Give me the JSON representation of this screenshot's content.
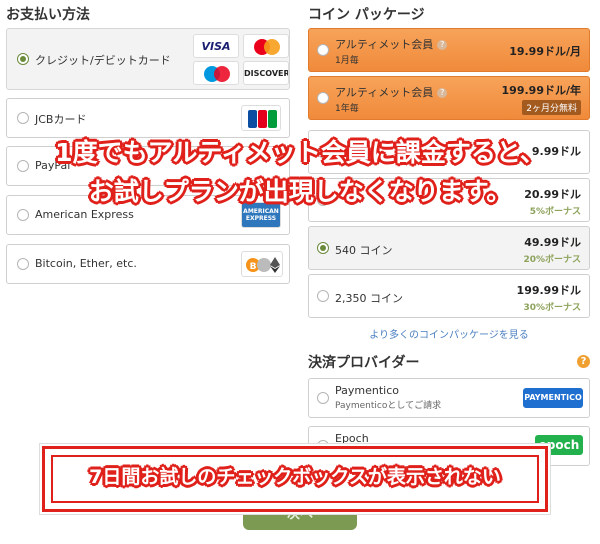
{
  "payment": {
    "title": "お支払い方法",
    "methods": [
      {
        "label": "クレジット/デビットカード",
        "selected": true
      },
      {
        "label": "JCBカード",
        "selected": false
      },
      {
        "label": "PayPal",
        "selected": false
      },
      {
        "label": "American Express",
        "selected": false
      },
      {
        "label": "Bitcoin, Ether, etc.",
        "selected": false
      }
    ],
    "logos": {
      "visa": "VISA",
      "discover": "DISCOVER",
      "jcb": "JCB",
      "amex": "AMERICAN EXPRESS"
    }
  },
  "coins": {
    "title": "コイン パッケージ",
    "packages": [
      {
        "name": "アルティメット会員",
        "sub": "1月毎",
        "price": "19.99ドル/月",
        "badge": ""
      },
      {
        "name": "アルティメット会員",
        "sub": "1年毎",
        "price": "199.99ドル/年",
        "badge": "2ヶ月分無料"
      },
      {
        "name": "",
        "sub": "",
        "price": "9.99ドル",
        "bonus": ""
      },
      {
        "name": "",
        "sub": "",
        "price": "20.99ドル",
        "bonus": "5%ボーナス"
      },
      {
        "name": "540 コイン",
        "sub": "",
        "price": "49.99ドル",
        "bonus": "20%ボーナス"
      },
      {
        "name": "2,350 コイン",
        "sub": "",
        "price": "199.99ドル",
        "bonus": "30%ボーナス"
      }
    ],
    "more_link": "より多くのコインパッケージを見る"
  },
  "providers": {
    "title": "決済プロバイダー",
    "help": "?",
    "items": [
      {
        "name": "Paymentico",
        "sub": "Paymenticoとしてご請求",
        "logo": "PAYMENTICO"
      },
      {
        "name": "Epoch",
        "sub": "",
        "logo": "epoch"
      }
    ]
  },
  "next_label": "次へ",
  "overlay": {
    "line1": "1度でもアルティメット会員に課金すると、",
    "line2": "お試しプランが出現しなくなります。",
    "callout": "7日間お試しのチェックボックスが表示されない"
  },
  "colors": {
    "accent": "#e0201a",
    "orange": "#f08a3a",
    "green": "#7c9a52",
    "link": "#4a7fc0"
  }
}
